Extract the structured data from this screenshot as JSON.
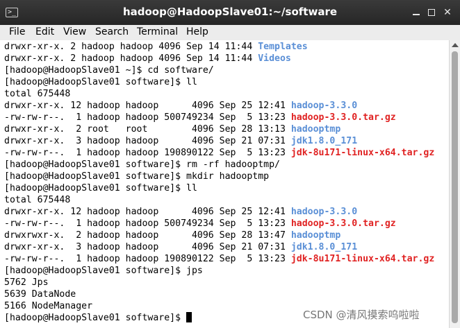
{
  "window": {
    "title": "hadoop@HadoopSlave01:~/software",
    "app_icon": "terminal-icon",
    "controls": [
      "minimize-icon",
      "maximize-icon",
      "close-icon"
    ],
    "close_glyph": "✕"
  },
  "menu": [
    "File",
    "Edit",
    "View",
    "Search",
    "Terminal",
    "Help"
  ],
  "terminal": {
    "lines": [
      [
        {
          "t": "drwxr-xr-x. 2 hadoop hadoop 4096 Sep 14 11:44 "
        },
        {
          "t": "Templates",
          "c": "blue"
        }
      ],
      [
        {
          "t": "drwxr-xr-x. 2 hadoop hadoop 4096 Sep 14 11:44 "
        },
        {
          "t": "Videos",
          "c": "blue"
        }
      ],
      [
        {
          "t": "[hadoop@HadoopSlave01 ~]$ cd software/"
        }
      ],
      [
        {
          "t": "[hadoop@HadoopSlave01 software]$ ll"
        }
      ],
      [
        {
          "t": "total 675448"
        }
      ],
      [
        {
          "t": "drwxr-xr-x. 12 hadoop hadoop      4096 Sep 25 12:41 "
        },
        {
          "t": "hadoop-3.3.0",
          "c": "blue"
        }
      ],
      [
        {
          "t": "-rw-rw-r--.  1 hadoop hadoop 500749234 Sep  5 13:23 "
        },
        {
          "t": "hadoop-3.3.0.tar.gz",
          "c": "red"
        }
      ],
      [
        {
          "t": "drwxr-xr-x.  2 root   root        4096 Sep 28 13:13 "
        },
        {
          "t": "hadooptmp",
          "c": "blue"
        }
      ],
      [
        {
          "t": "drwxr-xr-x.  3 hadoop hadoop      4096 Sep 21 07:31 "
        },
        {
          "t": "jdk1.8.0_171",
          "c": "blue"
        }
      ],
      [
        {
          "t": "-rw-rw-r--.  1 hadoop hadoop 190890122 Sep  5 13:23 "
        },
        {
          "t": "jdk-8u171-linux-x64.tar.gz",
          "c": "red"
        }
      ],
      [
        {
          "t": "[hadoop@HadoopSlave01 software]$ rm -rf hadooptmp/"
        }
      ],
      [
        {
          "t": "[hadoop@HadoopSlave01 software]$ mkdir hadooptmp"
        }
      ],
      [
        {
          "t": "[hadoop@HadoopSlave01 software]$ ll"
        }
      ],
      [
        {
          "t": "total 675448"
        }
      ],
      [
        {
          "t": "drwxr-xr-x. 12 hadoop hadoop      4096 Sep 25 12:41 "
        },
        {
          "t": "hadoop-3.3.0",
          "c": "blue"
        }
      ],
      [
        {
          "t": "-rw-rw-r--.  1 hadoop hadoop 500749234 Sep  5 13:23 "
        },
        {
          "t": "hadoop-3.3.0.tar.gz",
          "c": "red"
        }
      ],
      [
        {
          "t": "drwxrwxr-x.  2 hadoop hadoop      4096 Sep 28 13:47 "
        },
        {
          "t": "hadooptmp",
          "c": "blue"
        }
      ],
      [
        {
          "t": "drwxr-xr-x.  3 hadoop hadoop      4096 Sep 21 07:31 "
        },
        {
          "t": "jdk1.8.0_171",
          "c": "blue"
        }
      ],
      [
        {
          "t": "-rw-rw-r--.  1 hadoop hadoop 190890122 Sep  5 13:23 "
        },
        {
          "t": "jdk-8u171-linux-x64.tar.gz",
          "c": "red"
        }
      ],
      [
        {
          "t": "[hadoop@HadoopSlave01 software]$ jps"
        }
      ],
      [
        {
          "t": "5762 Jps"
        }
      ],
      [
        {
          "t": "5639 DataNode"
        }
      ],
      [
        {
          "t": "5166 NodeManager"
        }
      ],
      [
        {
          "t": "[hadoop@HadoopSlave01 software]$ "
        },
        {
          "cursor": true
        }
      ]
    ],
    "colors": {
      "blue": "#5a8fd6",
      "red": "#e02222",
      "text": "#000000",
      "background": "#ffffff"
    }
  },
  "scrollbar": {
    "up_icon": "arrow-up-icon"
  },
  "watermark": "CSDN @清风摸索呜啦啦"
}
